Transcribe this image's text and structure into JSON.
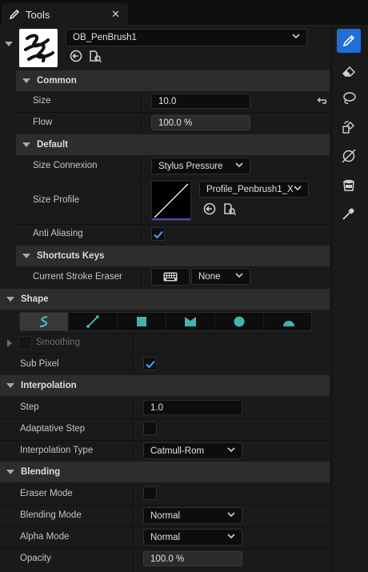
{
  "tab": {
    "title": "Tools",
    "close": "✕"
  },
  "brush": {
    "name": "OB_PenBrush1"
  },
  "sections": {
    "common": "Common",
    "default": "Default",
    "shortcuts": "Shortcuts Keys",
    "shape": "Shape",
    "interpolation": "Interpolation",
    "blending": "Blending"
  },
  "common": {
    "size_label": "Size",
    "size_value": "10.0",
    "flow_label": "Flow",
    "flow_value": "100.0 %",
    "flow_fill": 1.0
  },
  "default": {
    "size_connexion_label": "Size Connexion",
    "size_connexion_value": "Stylus Pressure",
    "size_profile_label": "Size Profile",
    "size_profile_value": "Profile_Penbrush1_X",
    "anti_aliasing_label": "Anti Aliasing",
    "anti_aliasing_checked": true
  },
  "shortcuts": {
    "eraser_label": "Current Stroke Eraser",
    "eraser_value": "None"
  },
  "shape": {
    "buttons": [
      "stroke-icon",
      "line-icon",
      "square-icon",
      "polygon-icon",
      "circle-icon",
      "arc-icon"
    ],
    "selected": 0,
    "smoothing_label": "Smoothing",
    "subpixel_label": "Sub Pixel",
    "subpixel_checked": true
  },
  "interpolation": {
    "step_label": "Step",
    "step_value": "1.0",
    "adaptative_label": "Adaptative Step",
    "adaptative_checked": false,
    "type_label": "Interpolation Type",
    "type_value": "Catmull-Rom"
  },
  "blending": {
    "eraser_mode_label": "Eraser Mode",
    "eraser_mode_checked": false,
    "blending_mode_label": "Blending Mode",
    "blending_mode_value": "Normal",
    "alpha_mode_label": "Alpha Mode",
    "alpha_mode_value": "Normal",
    "opacity_label": "Opacity",
    "opacity_value": "100.0 %",
    "opacity_fill": 1.0
  },
  "sidebar": [
    "pen-icon",
    "eraser-icon",
    "lasso-icon",
    "transform-icon",
    "shape-icon",
    "bucket-icon",
    "eyedropper-icon"
  ],
  "colors": {
    "accent": "#1e6fd8",
    "check": "#4aa3ff"
  }
}
